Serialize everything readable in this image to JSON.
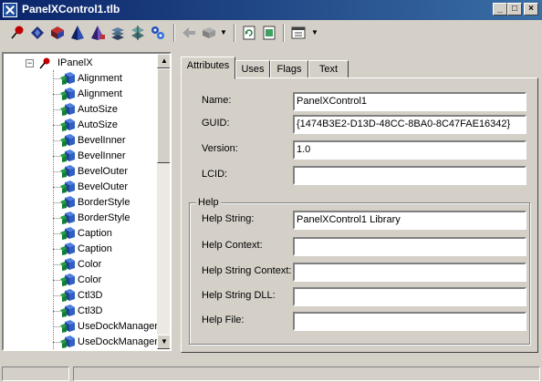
{
  "window": {
    "title": "PanelXControl1.tlb",
    "minimize_glyph": "_",
    "maximize_glyph": "□",
    "close_glyph": "×"
  },
  "toolbar": {
    "buttons": [
      {
        "icon": "pin-icon",
        "color": "#c00000"
      },
      {
        "icon": "diamond-icon",
        "color": "#203080"
      },
      {
        "icon": "cube-module-icon",
        "color": "#802020"
      },
      {
        "icon": "pyramid-icon",
        "color": "#204080"
      },
      {
        "icon": "pyramid-alt-icon",
        "color": "#6040a0"
      },
      {
        "icon": "layers-icon",
        "color": "#406080"
      },
      {
        "icon": "cross-layers-icon",
        "color": "#508080"
      },
      {
        "icon": "gears-icon",
        "color": "#2050c0"
      },
      {
        "icon": "back-arrow-icon",
        "color": "#909090"
      },
      {
        "icon": "box-icon",
        "color": "#909090"
      },
      {
        "icon": "refresh-icon",
        "color": "#208040"
      },
      {
        "icon": "document-icon",
        "color": "#408040"
      },
      {
        "icon": "view-options-icon",
        "color": "#404040"
      }
    ]
  },
  "tree": {
    "root_label": "IPanelX",
    "expander": "−",
    "items": [
      "Alignment",
      "Alignment",
      "AutoSize",
      "AutoSize",
      "BevelInner",
      "BevelInner",
      "BevelOuter",
      "BevelOuter",
      "BorderStyle",
      "BorderStyle",
      "Caption",
      "Caption",
      "Color",
      "Color",
      "Ctl3D",
      "Ctl3D",
      "UseDockManager",
      "UseDockManager"
    ],
    "scroll_up": "▲",
    "scroll_down": "▼"
  },
  "tabs": [
    "Attributes",
    "Uses",
    "Flags",
    "Text"
  ],
  "attributes": {
    "name_label": "Name:",
    "name_value": "PanelXControl1",
    "guid_label": "GUID:",
    "guid_value": "{1474B3E2-D13D-48CC-8BA0-8C47FAE16342}",
    "version_label": "Version:",
    "version_value": "1.0",
    "lcid_label": "LCID:",
    "lcid_value": ""
  },
  "help": {
    "group_label": "Help",
    "help_string_label": "Help String:",
    "help_string_value": "PanelXControl1 Library",
    "help_context_label": "Help Context:",
    "help_context_value": "",
    "help_string_context_label": "Help String Context:",
    "help_string_context_value": "",
    "help_string_dll_label": "Help String DLL:",
    "help_string_dll_value": "",
    "help_file_label": "Help File:",
    "help_file_value": ""
  }
}
